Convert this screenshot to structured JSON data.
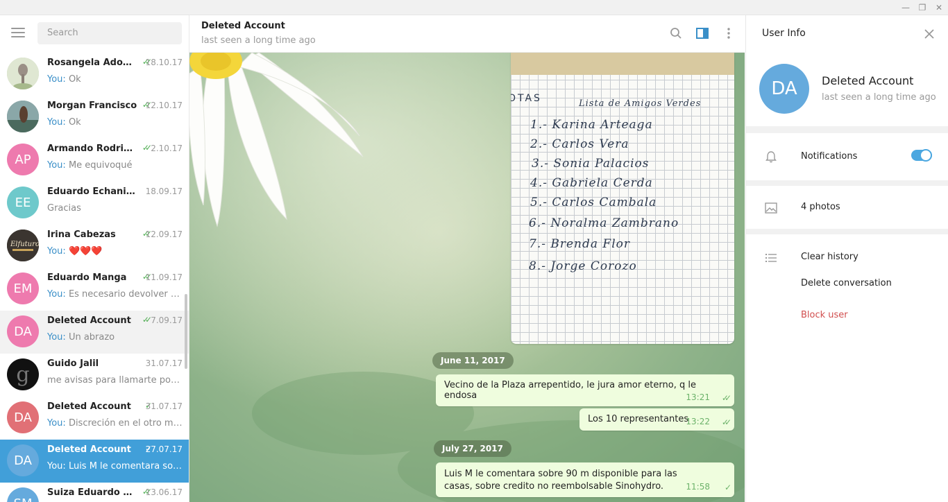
{
  "window": {
    "minimize": "—",
    "maximize": "❐",
    "close": "✕"
  },
  "sidebar": {
    "search_placeholder": "Search",
    "chats": [
      {
        "name": "Rosangela Adoum",
        "date": "18.10.17",
        "you": "You:",
        "msg": "Ok",
        "initials": "",
        "color": "#b7c6a3",
        "read": "✓✓"
      },
      {
        "name": "Morgan Francisco",
        "date": "12.10.17",
        "you": "You:",
        "msg": "Ok",
        "initials": "",
        "color": "#6f8b83",
        "read": "✓✓"
      },
      {
        "name": "Armando Rodrigo ...",
        "date": "2.10.17",
        "you": "You:",
        "msg": "Me equivoqué",
        "initials": "AP",
        "color": "#ee7aae",
        "read": "✓✓"
      },
      {
        "name": "Eduardo Echanique",
        "date": "18.09.17",
        "you": "",
        "msg": "Gracias",
        "initials": "EE",
        "color": "#6ec9cb",
        "read": ""
      },
      {
        "name": "Irina Cabezas",
        "date": "12.09.17",
        "you": "You:",
        "msg": "❤️❤️❤️",
        "initials": "",
        "color": "#3b3530",
        "read": "✓✓"
      },
      {
        "name": "Eduardo Manga",
        "date": "11.09.17",
        "you": "You:",
        "msg": "Es necesario devolver doc...",
        "initials": "EM",
        "color": "#ee7aae",
        "read": "✓✓"
      },
      {
        "name": "Deleted Account",
        "date": "7.09.17",
        "you": "You:",
        "msg": "Un abrazo",
        "initials": "DA",
        "color": "#ee7aae",
        "read": "✓✓"
      },
      {
        "name": "Guido Jalil",
        "date": "31.07.17",
        "you": "",
        "msg": "me avisas para llamarte por fa",
        "initials": "g",
        "color": "#111111",
        "read": ""
      },
      {
        "name": "Deleted Account",
        "date": "31.07.17",
        "you": "You:",
        "msg": "Discreción en el otro medio.",
        "initials": "DA",
        "color": "#e17076",
        "read": "✓"
      },
      {
        "name": "Deleted Account",
        "date": "27.07.17",
        "you": "You:",
        "msg": "Luis M le comentara sobre...",
        "initials": "DA",
        "color": "#65aadd",
        "read": "✓"
      },
      {
        "name": "Suiza Eduardo M...",
        "date": "13.06.17",
        "you": "",
        "msg": "",
        "initials": "SM",
        "color": "#65aadd",
        "read": "✓✓"
      }
    ]
  },
  "chat": {
    "title": "Deleted Account",
    "status": "last seen a long time ago",
    "photo_lines": [
      "OTAS",
      "Lista de Amigos Verdes",
      "1.- Karina Arteaga",
      "2.- Carlos Vera",
      "3.- Sonia Palacios",
      "4.- Gabriela Cerda",
      "5.- Carlos Cambala",
      "6.- Noralma Zambrano",
      "7.- Brenda Flor",
      "8.- Jorge Corozo"
    ],
    "days": [
      "June 11, 2017",
      "July 27, 2017"
    ],
    "messages": [
      {
        "text": "Vecino de la Plaza arrepentido, le jura amor eterno, q le endosa",
        "time": "13:21",
        "check": "✓✓"
      },
      {
        "text": "Los 10 representantes",
        "time": "13:22",
        "check": "✓✓"
      },
      {
        "text": "Luis M le comentara sobre 90 m  disponible para las casas, sobre credito no reembolsable Sinohydro.",
        "time": "11:58",
        "check": "✓"
      }
    ]
  },
  "info": {
    "title": "User Info",
    "avatar": "DA",
    "name": "Deleted Account",
    "status": "last seen a long time ago",
    "notifications": "Notifications",
    "notifications_on": true,
    "photos": "4 photos",
    "clear_history": "Clear history",
    "delete_conversation": "Delete conversation",
    "block_user": "Block user",
    "block_color": "#d14e4e"
  }
}
